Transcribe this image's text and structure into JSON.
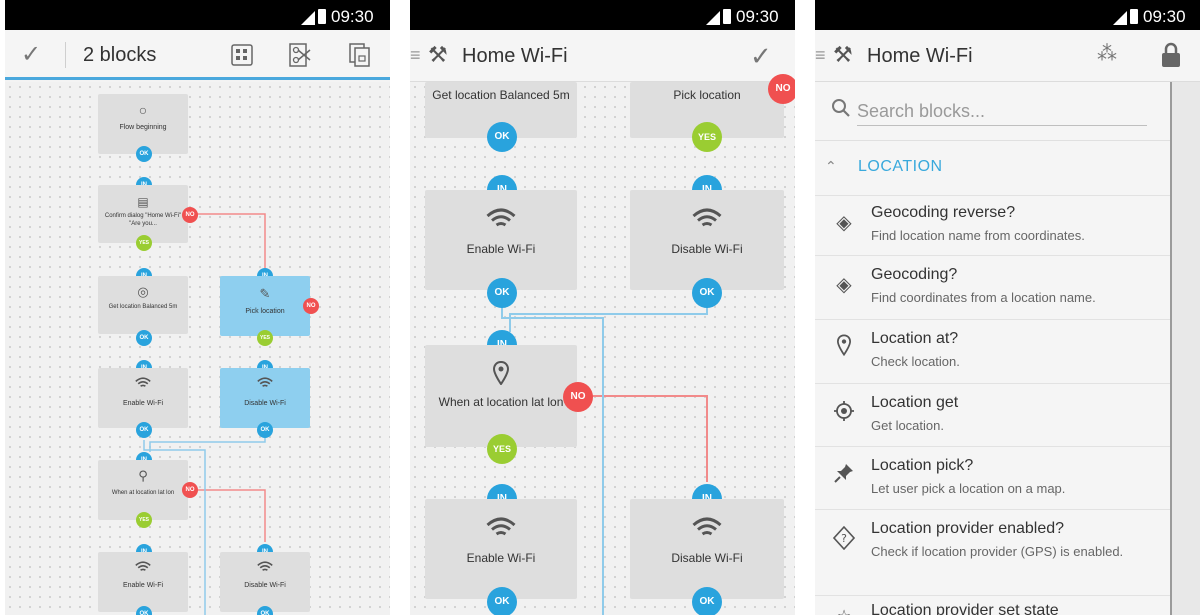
{
  "status": {
    "time": "09:30"
  },
  "p1": {
    "title": "2 blocks",
    "blocks": {
      "begin": "Flow beginning",
      "confirm": "Confirm dialog \"Home Wi-Fi\" \"Are you...",
      "getloc": "Get location Balanced 5m",
      "pick": "Pick location",
      "en1": "Enable Wi-Fi",
      "dis1": "Disable Wi-Fi",
      "when": "When at location lat lon",
      "en2": "Enable Wi-Fi",
      "dis2": "Disable Wi-Fi"
    }
  },
  "p2": {
    "title": "Home Wi-Fi",
    "blocks": {
      "getloc": "Get location Balanced 5m",
      "pick": "Pick location",
      "en1": "Enable Wi-Fi",
      "dis1": "Disable Wi-Fi",
      "when": "When at location lat lon",
      "en2": "Enable Wi-Fi",
      "dis2": "Disable Wi-Fi"
    }
  },
  "p3": {
    "title": "Home Wi-Fi",
    "search_placeholder": "Search blocks...",
    "section": "LOCATION",
    "items": [
      {
        "title": "Geocoding reverse?",
        "desc": "Find location name from coordinates.",
        "icon": "diamond-arrow-icon"
      },
      {
        "title": "Geocoding?",
        "desc": "Find coordinates from a location name.",
        "icon": "diamond-arrow-icon"
      },
      {
        "title": "Location at?",
        "desc": "Check location.",
        "icon": "map-pin-icon"
      },
      {
        "title": "Location get",
        "desc": "Get location.",
        "icon": "crosshair-icon"
      },
      {
        "title": "Location pick?",
        "desc": "Let user pick a location on a map.",
        "icon": "push-pin-icon"
      },
      {
        "title": "Location provider enabled?",
        "desc": "Check if location provider (GPS) is enabled.",
        "icon": "provider-icon"
      },
      {
        "title": "Location provider set state",
        "desc": "",
        "icon": "star-icon"
      }
    ]
  },
  "ports": {
    "in": "IN",
    "ok": "OK",
    "yes": "YES",
    "no": "NO"
  },
  "colors": {
    "accent": "#29a3dd",
    "yes": "#9acd32",
    "no": "#f05050",
    "selected": "#8ecfef"
  }
}
